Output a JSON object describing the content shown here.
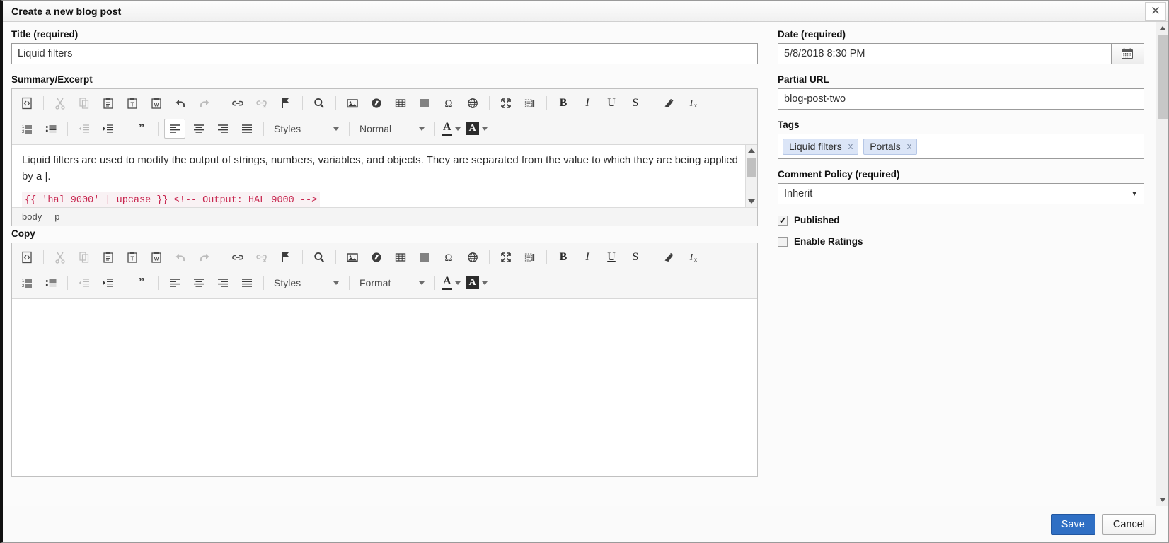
{
  "window": {
    "title": "Create a new blog post",
    "close_label": "✕"
  },
  "left": {
    "title_label": "Title (required)",
    "title_value": "Liquid filters",
    "summary_label": "Summary/Excerpt",
    "copy_label": "Copy",
    "summary_editor": {
      "paragraph": "Liquid filters are used to modify the output of strings, numbers, variables, and objects. They are separated from the value to which they are being applied by a |.",
      "code": "{{ 'hal 9000' | upcase }} <!-- Output: HAL 9000 -->",
      "status_path": [
        "body",
        "p"
      ],
      "styles_label": "Styles",
      "format_label": "Normal"
    },
    "copy_editor": {
      "styles_label": "Styles",
      "format_label": "Format"
    },
    "toolbar_icons": [
      "source-icon",
      "cut-icon",
      "copy-icon",
      "paste-icon",
      "paste-text-icon",
      "paste-word-icon",
      "undo-icon",
      "redo-icon",
      "link-icon",
      "unlink-icon",
      "anchor-icon",
      "find-icon",
      "image-icon",
      "flash-icon",
      "table-icon",
      "horizontal-rule-icon",
      "special-char-icon",
      "iframe-icon",
      "maximize-icon",
      "show-blocks-icon",
      "bold-icon",
      "italic-icon",
      "underline-icon",
      "strikethrough-icon",
      "remove-format-icon",
      "subscript-icon"
    ],
    "toolbar_icons_row2": [
      "numbered-list-icon",
      "bulleted-list-icon",
      "outdent-icon",
      "indent-icon",
      "blockquote-icon",
      "align-left-icon",
      "align-center-icon",
      "align-right-icon",
      "justify-icon",
      "text-color-icon",
      "bg-color-icon"
    ]
  },
  "right": {
    "date_label": "Date (required)",
    "date_value": "5/8/2018 8:30 PM",
    "calendar_icon": "calendar-icon",
    "url_label": "Partial URL",
    "url_value": "blog-post-two",
    "tags_label": "Tags",
    "tags": [
      {
        "name": "Liquid filters",
        "remove": "x"
      },
      {
        "name": "Portals",
        "remove": "x"
      }
    ],
    "comment_policy_label": "Comment Policy (required)",
    "comment_policy_value": "Inherit",
    "comment_policy_arrow": "▼",
    "published_label": "Published",
    "published_checked": "✔",
    "ratings_label": "Enable Ratings",
    "ratings_checked": ""
  },
  "footer": {
    "save_label": "Save",
    "cancel_label": "Cancel"
  },
  "colors": {
    "primary": "#2f6fc4",
    "tag_bg": "#dbe5f7",
    "code_color": "#c7254e",
    "code_bg": "#f9f2f4"
  }
}
